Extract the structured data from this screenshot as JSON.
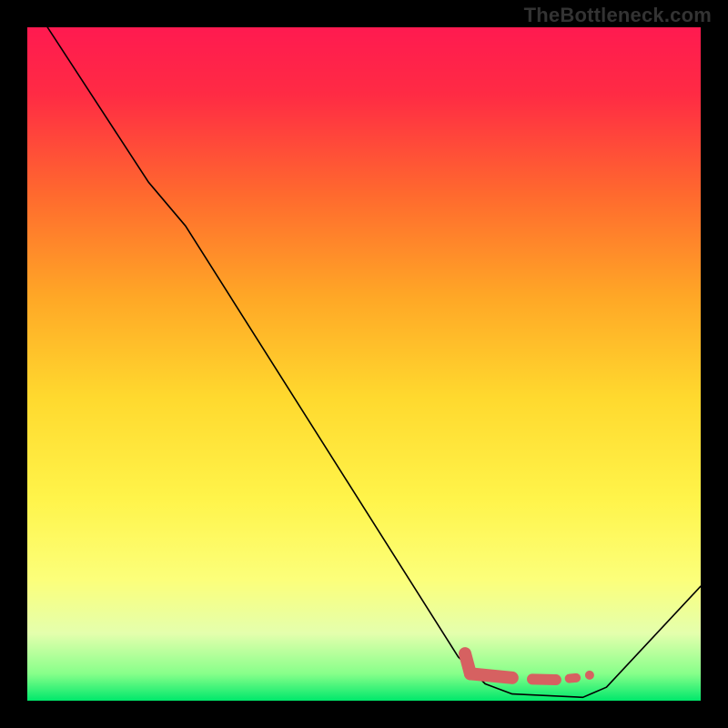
{
  "watermark": "TheBottleneck.com",
  "chart_data": {
    "type": "line",
    "title": "",
    "xlabel": "",
    "ylabel": "",
    "xlim": [
      0,
      100
    ],
    "ylim": [
      0,
      100
    ],
    "background_gradient": {
      "stops": [
        {
          "offset": 0.0,
          "color": "#ff1a50"
        },
        {
          "offset": 0.1,
          "color": "#ff2b44"
        },
        {
          "offset": 0.25,
          "color": "#ff6a2e"
        },
        {
          "offset": 0.4,
          "color": "#ffa726"
        },
        {
          "offset": 0.55,
          "color": "#ffd92e"
        },
        {
          "offset": 0.7,
          "color": "#fff44a"
        },
        {
          "offset": 0.82,
          "color": "#fcff7a"
        },
        {
          "offset": 0.9,
          "color": "#e4ffad"
        },
        {
          "offset": 0.96,
          "color": "#87ff8a"
        },
        {
          "offset": 1.0,
          "color": "#00e86b"
        }
      ]
    },
    "series": [
      {
        "name": "bottleneck-curve",
        "stroke": "#000000",
        "stroke_width": 1.6,
        "points": [
          {
            "x": 3.0,
            "y": 100.0
          },
          {
            "x": 18.0,
            "y": 77.0
          },
          {
            "x": 23.5,
            "y": 70.5
          },
          {
            "x": 64.0,
            "y": 6.5
          },
          {
            "x": 68.0,
            "y": 2.5
          },
          {
            "x": 72.0,
            "y": 1.0
          },
          {
            "x": 82.5,
            "y": 0.5
          },
          {
            "x": 86.0,
            "y": 2.0
          },
          {
            "x": 100.0,
            "y": 17.0
          }
        ]
      }
    ],
    "markers": {
      "name": "bottom-highlight",
      "color": "#d66161",
      "segments": [
        {
          "x1": 65.0,
          "y1": 7.0,
          "x2": 65.8,
          "y2": 4.0,
          "w": 14
        },
        {
          "x1": 65.8,
          "y1": 4.0,
          "x2": 72.0,
          "y2": 3.4,
          "w": 14
        },
        {
          "x1": 75.0,
          "y1": 3.2,
          "x2": 78.5,
          "y2": 3.1,
          "w": 12
        },
        {
          "x1": 80.5,
          "y1": 3.3,
          "x2": 81.5,
          "y2": 3.4,
          "w": 10
        }
      ],
      "dots": [
        {
          "x": 83.5,
          "y": 3.8,
          "r": 5
        }
      ]
    }
  }
}
